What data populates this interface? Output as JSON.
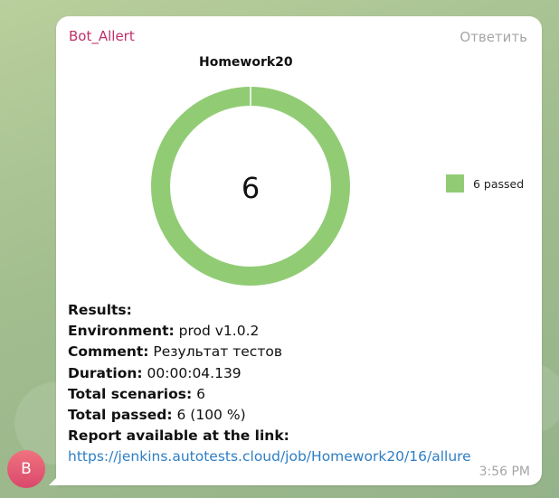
{
  "message": {
    "sender": "Bot_Allert",
    "reply_label": "Ответить",
    "time": "3:56 PM",
    "avatar_letter": "B"
  },
  "chart_data": {
    "type": "pie",
    "title": "Homework20",
    "center_label": "6",
    "slices": [
      {
        "label": "6 passed",
        "value": 6,
        "color": "#91cc75"
      }
    ],
    "legend_position": "right"
  },
  "results": {
    "heading": "Results:",
    "environment_label": "Environment:",
    "environment_value": "prod v1.0.2",
    "comment_label": "Comment:",
    "comment_value": "Результат тестов",
    "duration_label": "Duration:",
    "duration_value": "00:00:04.139",
    "total_scenarios_label": "Total scenarios:",
    "total_scenarios_value": "6",
    "total_passed_label": "Total passed:",
    "total_passed_value": "6 (100 %)",
    "report_label": "Report available at the link:",
    "report_url": "https://jenkins.autotests.cloud/job/Homework20/16/allure"
  }
}
